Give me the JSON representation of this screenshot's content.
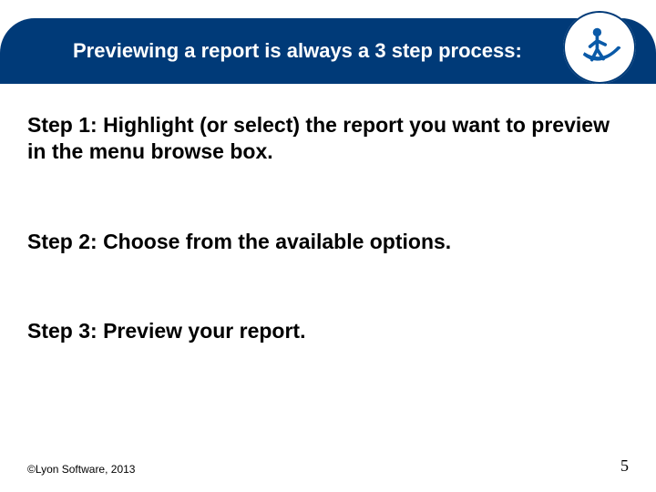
{
  "header": {
    "title": "Previewing a report is always a 3 step process:"
  },
  "steps": {
    "s1": "Step 1:  Highlight (or select) the report you want to preview in the menu browse box.",
    "s2": "Step 2:  Choose from the available options.",
    "s3": "Step 3:  Preview your report."
  },
  "footer": {
    "copyright": "©Lyon Software, 2013",
    "page": "5"
  },
  "icons": {
    "logo": "person-swoosh-icon"
  },
  "colors": {
    "brand": "#003a78",
    "accent": "#0a5aa8"
  }
}
